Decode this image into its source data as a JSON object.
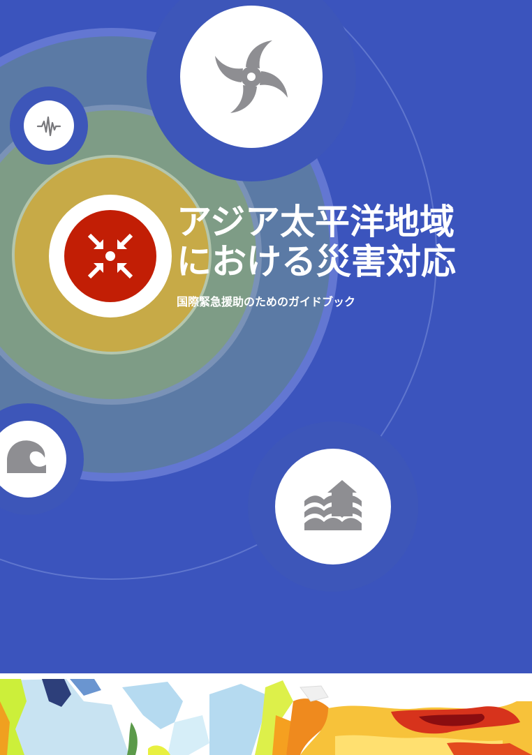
{
  "cover": {
    "title_line_1": "アジア太平洋地域",
    "title_line_2": "における災害対応",
    "subtitle": "国際緊急援助のためのガイドブック"
  },
  "colors": {
    "background": "#3b54bd",
    "ring_outer": "#6b7ed6",
    "ring_middle": "#5b7aa5",
    "ring_inner": "#7e9c86",
    "core": "#c7aa47",
    "icon_accent": "#c21e05",
    "icon_gray": "#8e8e92"
  },
  "icons": {
    "hazards": [
      "earthquake-icon",
      "cyclone-icon",
      "tsunami-icon",
      "flood-icon"
    ],
    "center": "assembly-point-icon",
    "bottom": "hazard-map"
  }
}
